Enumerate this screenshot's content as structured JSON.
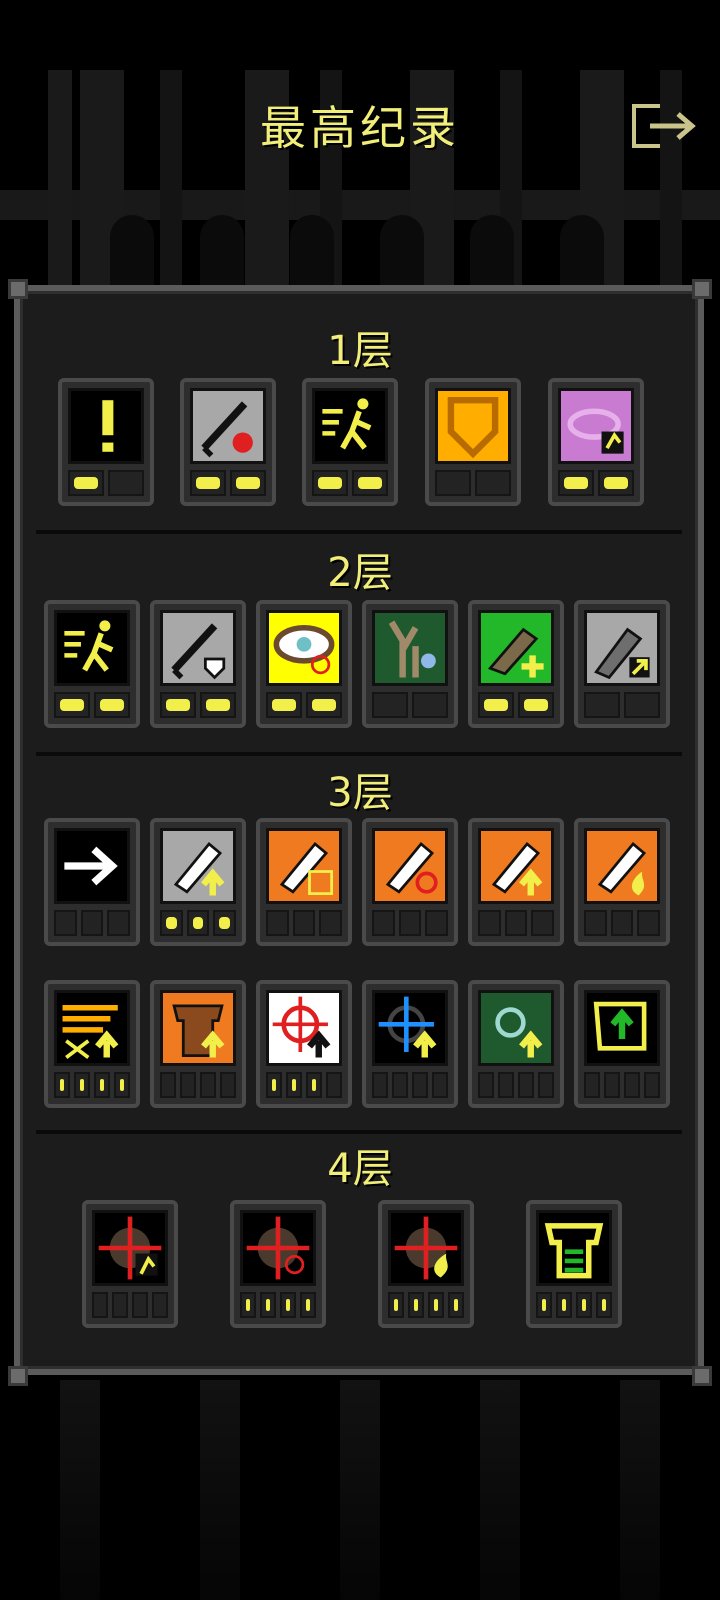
{
  "title": "最高纪录",
  "exit_icon": "exit-door-icon",
  "colors": {
    "title": "#f2ee7a",
    "pip_on": "#f2ee4a",
    "panel": "#1c1c1c"
  },
  "tiers": [
    {
      "label": "1层",
      "badges": [
        {
          "icon": "exclamation-icon",
          "bg": "#000000",
          "pips": [
            true,
            false
          ]
        },
        {
          "icon": "sword-strength-icon",
          "bg": "#a8a8a8",
          "pips": [
            true,
            true
          ]
        },
        {
          "icon": "dash-icon",
          "bg": "#000000",
          "pips": [
            true,
            true
          ]
        },
        {
          "icon": "shield-icon",
          "bg": "#ffae00",
          "pips": [
            false,
            false
          ]
        },
        {
          "icon": "eye-runner-icon",
          "bg": "#c97ad1",
          "pips": [
            true,
            true
          ]
        }
      ]
    },
    {
      "label": "2层",
      "badges": [
        {
          "icon": "dash-icon",
          "bg": "#000000",
          "pips": [
            true,
            true
          ]
        },
        {
          "icon": "sword-shield-icon",
          "bg": "#a8a8a8",
          "pips": [
            true,
            true
          ]
        },
        {
          "icon": "eye-target-icon",
          "bg": "#ffff00",
          "pips": [
            true,
            true
          ]
        },
        {
          "icon": "tree-ghost-icon",
          "bg": "#1f5a2e",
          "pips": [
            false,
            false
          ]
        },
        {
          "icon": "wand-plus-icon",
          "bg": "#22b82a",
          "pips": [
            true,
            true
          ]
        },
        {
          "icon": "wand-arrow-icon",
          "bg": "#a8a8a8",
          "pips": [
            false,
            false
          ]
        }
      ]
    },
    {
      "label": "3层",
      "badges": [
        {
          "icon": "arrow-right-icon",
          "bg": "#000000",
          "pips": [
            false,
            false,
            false
          ]
        },
        {
          "icon": "scroll-up-icon",
          "bg": "#a8a8a8",
          "pips": [
            true,
            true,
            true
          ]
        },
        {
          "icon": "scroll-swap-icon",
          "bg": "#f07a20",
          "pips": [
            false,
            false,
            false
          ]
        },
        {
          "icon": "scroll-target-icon",
          "bg": "#f07a20",
          "pips": [
            false,
            false,
            false
          ]
        },
        {
          "icon": "scroll-up-icon",
          "bg": "#f07a20",
          "pips": [
            false,
            false,
            false
          ]
        },
        {
          "icon": "scroll-flame-icon",
          "bg": "#f07a20",
          "pips": [
            false,
            false,
            false
          ]
        },
        {
          "icon": "speed-up-icon",
          "bg": "#000000",
          "pips": [
            true,
            true,
            true,
            true
          ]
        },
        {
          "icon": "armor-up-icon",
          "bg": "#f07a20",
          "pips": [
            false,
            false,
            false,
            false
          ]
        },
        {
          "icon": "crosshair-up-icon",
          "bg": "#ffffff",
          "pips": [
            true,
            true,
            true,
            false
          ]
        },
        {
          "icon": "blue-crosshair-up-icon",
          "bg": "#000000",
          "pips": [
            false,
            false,
            false,
            false
          ]
        },
        {
          "icon": "ring-up-icon",
          "bg": "#1f5a2e",
          "pips": [
            false,
            false,
            false,
            false
          ]
        },
        {
          "icon": "scroll-upgrade-icon",
          "bg": "#000000",
          "pips": [
            false,
            false,
            false,
            false
          ]
        }
      ]
    },
    {
      "label": "4层",
      "badges": [
        {
          "icon": "target-runner-icon",
          "bg": "#000000",
          "pips": [
            false,
            false,
            false,
            false
          ]
        },
        {
          "icon": "target-crosshair-icon",
          "bg": "#000000",
          "pips": [
            true,
            true,
            true,
            true
          ]
        },
        {
          "icon": "target-flame-icon",
          "bg": "#000000",
          "pips": [
            true,
            true,
            true,
            true
          ]
        },
        {
          "icon": "tunic-icon",
          "bg": "#000000",
          "pips": [
            true,
            true,
            true,
            true
          ]
        }
      ]
    }
  ]
}
